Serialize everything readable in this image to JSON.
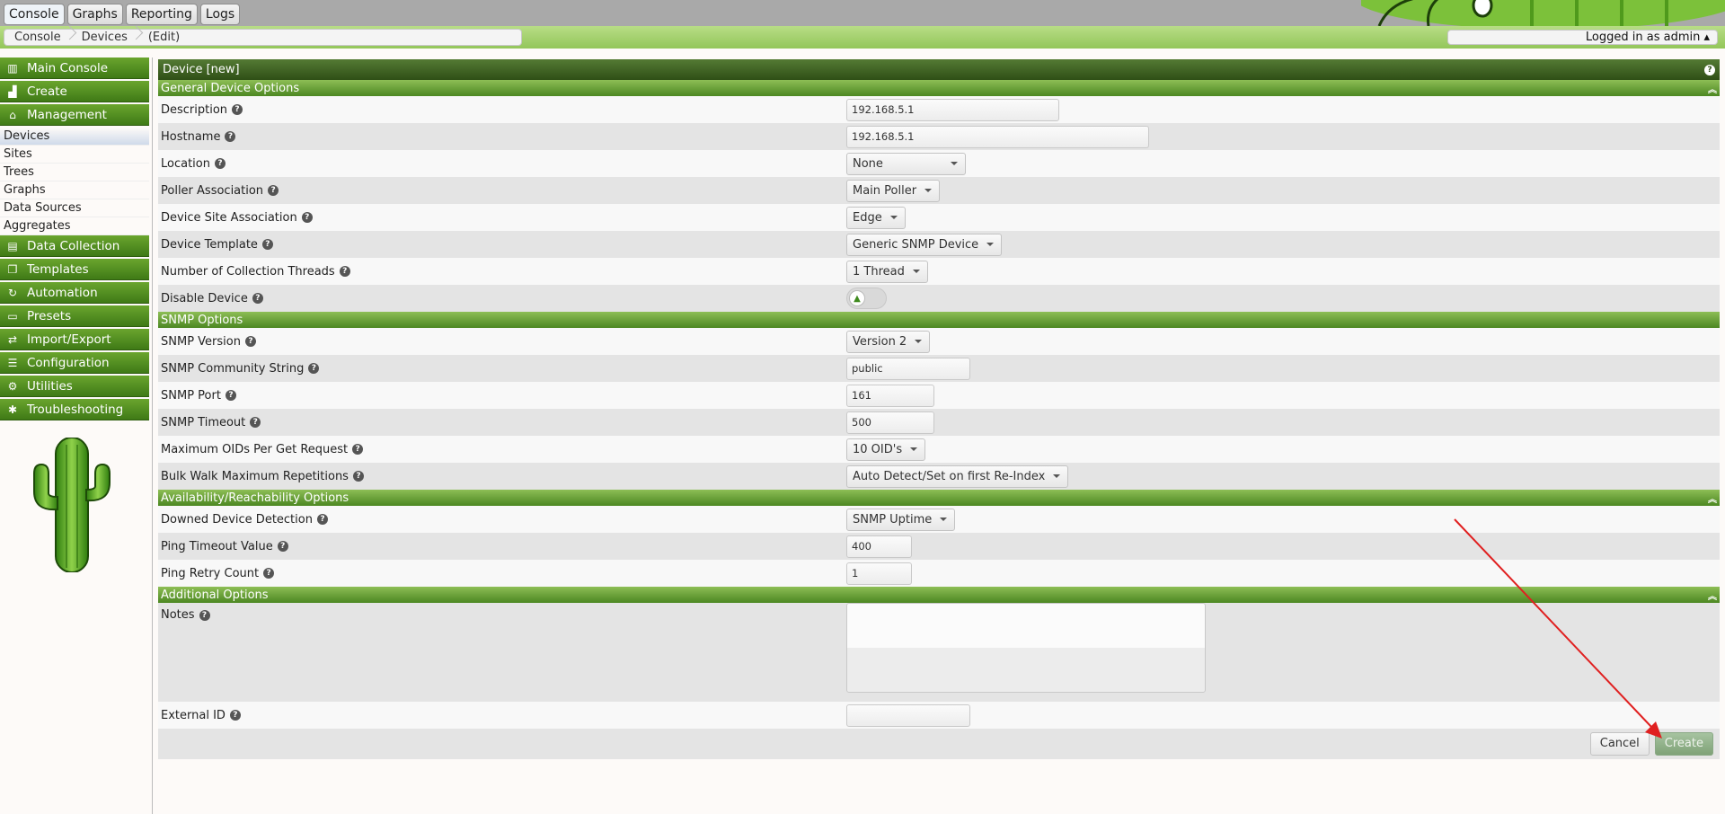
{
  "top_tabs": [
    "Console",
    "Graphs",
    "Reporting",
    "Logs"
  ],
  "breadcrumb": [
    "Console",
    "Devices",
    "(Edit)"
  ],
  "user": {
    "logged_in_text": "Logged in as admin ▴"
  },
  "sidebar": {
    "headers": [
      "Main Console",
      "Create",
      "Management",
      "Data Collection",
      "Templates",
      "Automation",
      "Presets",
      "Import/Export",
      "Configuration",
      "Utilities",
      "Troubleshooting"
    ],
    "management_items": [
      "Devices",
      "Sites",
      "Trees",
      "Graphs",
      "Data Sources",
      "Aggregates"
    ]
  },
  "panel": {
    "title": "Device [new]",
    "help": "?"
  },
  "sections": {
    "general": "General Device Options",
    "snmp": "SNMP Options",
    "availability": "Availability/Reachability Options",
    "additional": "Additional Options"
  },
  "fields": {
    "description": {
      "label": "Description",
      "value": "192.168.5.1"
    },
    "hostname": {
      "label": "Hostname",
      "value": "192.168.5.1"
    },
    "location": {
      "label": "Location",
      "value": "None"
    },
    "poller": {
      "label": "Poller Association",
      "value": "Main Poller"
    },
    "site": {
      "label": "Device Site Association",
      "value": "Edge"
    },
    "template": {
      "label": "Device Template",
      "value": "Generic SNMP Device"
    },
    "threads": {
      "label": "Number of Collection Threads",
      "value": "1 Thread"
    },
    "disable": {
      "label": "Disable Device",
      "enabled": false
    },
    "snmp_version": {
      "label": "SNMP Version",
      "value": "Version 2"
    },
    "community": {
      "label": "SNMP Community String",
      "value": "public"
    },
    "snmp_port": {
      "label": "SNMP Port",
      "value": "161"
    },
    "snmp_timeout": {
      "label": "SNMP Timeout",
      "value": "500"
    },
    "max_oids": {
      "label": "Maximum OIDs Per Get Request",
      "value": "10 OID's"
    },
    "bulk_walk": {
      "label": "Bulk Walk Maximum Repetitions",
      "value": "Auto Detect/Set on first Re-Index"
    },
    "downed_detection": {
      "label": "Downed Device Detection",
      "value": "SNMP Uptime"
    },
    "ping_timeout": {
      "label": "Ping Timeout Value",
      "value": "400"
    },
    "ping_retry": {
      "label": "Ping Retry Count",
      "value": "1"
    },
    "notes": {
      "label": "Notes",
      "value": ""
    },
    "external_id": {
      "label": "External ID",
      "value": ""
    }
  },
  "buttons": {
    "cancel": "Cancel",
    "create": "Create"
  },
  "colors": {
    "accent": "#4c8722",
    "arrow": "#e02020"
  }
}
